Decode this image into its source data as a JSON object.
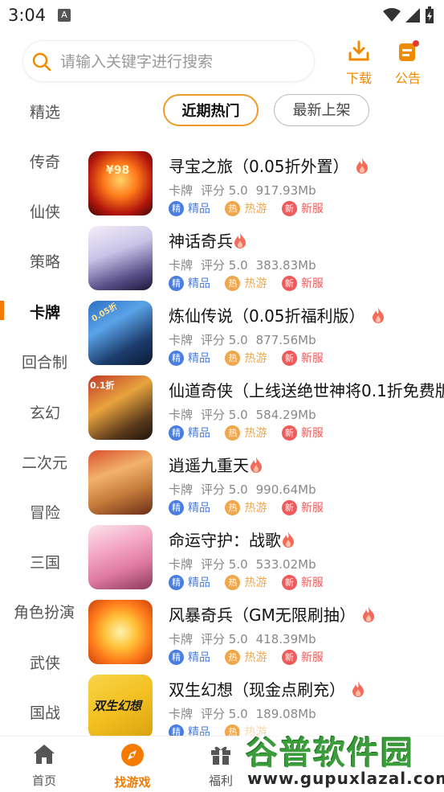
{
  "status_bar": {
    "time": "3:04",
    "notif_letter": "A"
  },
  "search": {
    "placeholder": "请输入关键字进行搜索"
  },
  "top_actions": {
    "download": "下载",
    "notice": "公告"
  },
  "sidebar": {
    "items": [
      "精选",
      "传奇",
      "仙侠",
      "策略",
      "卡牌",
      "回合制",
      "玄幻",
      "二次元",
      "冒险",
      "三国",
      "角色扮演",
      "武侠",
      "国战"
    ],
    "active": "卡牌"
  },
  "filters": {
    "recent_hot": "近期热门",
    "newest": "最新上架"
  },
  "tag_labels": {
    "jing_badge": "精",
    "jing": "精品",
    "re_badge": "热",
    "re": "热游",
    "xin_badge": "新",
    "xin": "新服"
  },
  "games": [
    {
      "title": "寻宝之旅（0.05折外置）",
      "category": "卡牌",
      "rating": "评分 5.0",
      "size": "917.93Mb",
      "icon_text": "¥98"
    },
    {
      "title": "神话奇兵",
      "category": "卡牌",
      "rating": "评分 5.0",
      "size": "383.83Mb",
      "icon_text": ""
    },
    {
      "title": "炼仙传说（0.05折福利版）",
      "category": "卡牌",
      "rating": "评分 5.0",
      "size": "877.56Mb",
      "icon_text": "0.05折"
    },
    {
      "title": "仙道奇侠（上线送绝世神将0.1折免费版",
      "category": "卡牌",
      "rating": "评分 5.0",
      "size": "584.29Mb",
      "icon_text": "0.1折"
    },
    {
      "title": "逍遥九重天",
      "category": "卡牌",
      "rating": "评分 5.0",
      "size": "990.64Mb",
      "icon_text": ""
    },
    {
      "title": "命运守护：战歌",
      "category": "卡牌",
      "rating": "评分 5.0",
      "size": "533.02Mb",
      "icon_text": ""
    },
    {
      "title": "风暴奇兵（GM无限刷抽）",
      "category": "卡牌",
      "rating": "评分 5.0",
      "size": "418.39Mb",
      "icon_text": ""
    },
    {
      "title": "双生幻想（现金点刷充）",
      "category": "卡牌",
      "rating": "评分 5.0",
      "size": "189.08Mb",
      "icon_text": "双生幻想"
    }
  ],
  "tabs": [
    "首页",
    "找游戏",
    "福利"
  ],
  "active_tab": "找游戏",
  "watermark": {
    "main": "谷普软件园",
    "url": "www.gupuxlazal.com"
  },
  "colors": {
    "accent": "#f47b00",
    "blue": "#4a7de0",
    "orange": "#f0a64a",
    "red": "#ef5a5a"
  }
}
